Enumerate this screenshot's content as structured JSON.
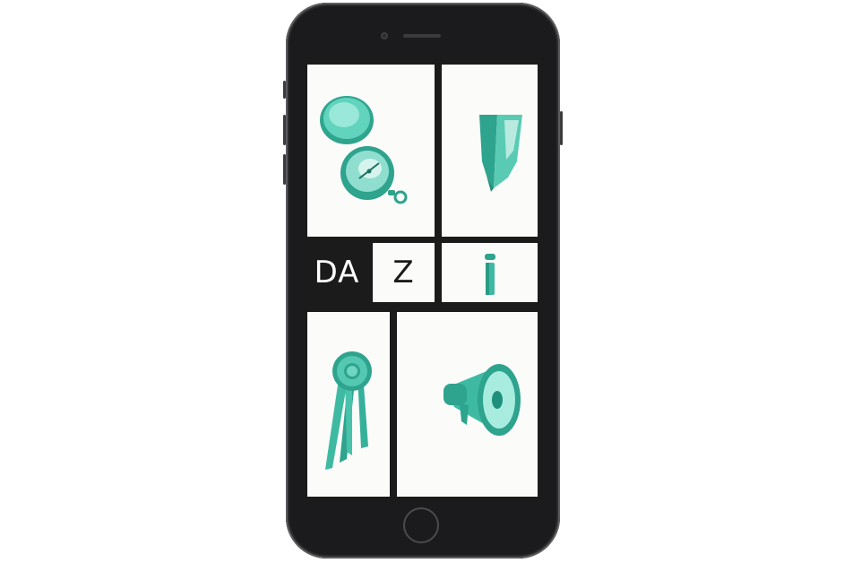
{
  "app": {
    "logo_part_dark": "DA",
    "logo_part_light": "Z"
  },
  "colors": {
    "accent": "#3ebaa2",
    "accent_dark": "#1e8f7a",
    "tile_bg": "#fbfbf9",
    "grid_bg": "#1b1b1b",
    "phone_body": "#1b1b1d"
  },
  "tiles": [
    {
      "id": "compass",
      "icon": "compass-icon"
    },
    {
      "id": "pencil",
      "icon": "pencil-icon"
    },
    {
      "id": "info",
      "icon": "info-icon"
    },
    {
      "id": "ribbon",
      "icon": "award-ribbon-icon"
    },
    {
      "id": "megaphone",
      "icon": "megaphone-icon"
    }
  ]
}
